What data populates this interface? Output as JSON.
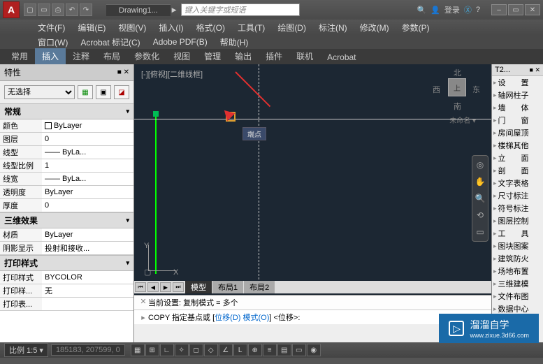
{
  "title": {
    "drawing": "Drawing1...",
    "search_placeholder": "键入关键字或短语",
    "login": "登录"
  },
  "menu1": [
    "文件(F)",
    "编辑(E)",
    "视图(V)",
    "插入(I)",
    "格式(O)",
    "工具(T)",
    "绘图(D)",
    "标注(N)",
    "修改(M)",
    "参数(P)"
  ],
  "menu2": [
    "窗口(W)",
    "Acrobat 标记(C)",
    "Adobe PDF(B)",
    "帮助(H)"
  ],
  "ribbon": [
    "常用",
    "插入",
    "注释",
    "布局",
    "参数化",
    "视图",
    "管理",
    "输出",
    "插件",
    "联机",
    "Acrobat"
  ],
  "ribbon_active": 1,
  "props": {
    "title": "特性",
    "selection": "无选择",
    "sections": {
      "general": {
        "label": "常规",
        "rows": [
          [
            "颜色",
            "ByLayer"
          ],
          [
            "图层",
            "0"
          ],
          [
            "线型",
            "—— ByLa..."
          ],
          [
            "线型比例",
            "1"
          ],
          [
            "线宽",
            "—— ByLa..."
          ],
          [
            "透明度",
            "ByLayer"
          ],
          [
            "厚度",
            "0"
          ]
        ]
      },
      "threeD": {
        "label": "三维效果",
        "rows": [
          [
            "材质",
            "ByLayer"
          ],
          [
            "阴影显示",
            "投射和接收..."
          ]
        ]
      },
      "plot": {
        "label": "打印样式",
        "rows": [
          [
            "打印样式",
            "BYCOLOR"
          ],
          [
            "打印样...",
            "无"
          ],
          [
            "打印表...",
            ""
          ]
        ]
      }
    }
  },
  "canvas": {
    "viewport": "[-][俯视][二维线框]",
    "snap_tip": "端点",
    "viewcube": {
      "n": "北",
      "s": "南",
      "e": "东",
      "w": "西",
      "top": "上"
    },
    "wcs": "未命名 ▾",
    "ucs": {
      "x": "X",
      "y": "Y"
    },
    "tabs": [
      "模型",
      "布局1",
      "布局2"
    ]
  },
  "cmd": {
    "hist": "当前设置:  复制模式 = 多个",
    "prompt_pre": "COPY 指定基点或 [",
    "opt1": "位移(D)",
    "opt_sep": " ",
    "opt2": "模式(O)",
    "prompt_post": "] <位移>:"
  },
  "right_palette": {
    "title": "T2...",
    "items": [
      "设　　置",
      "轴网柱子",
      "墙　　体",
      "门　　窗",
      "房间屋顶",
      "楼梯其他",
      "立　　面",
      "剖　　面",
      "文字表格",
      "尺寸标注",
      "符号标注",
      "图层控制",
      "工　　具",
      "图块图案",
      "建筑防火",
      "场地布置",
      "三维建模",
      "文件布图",
      "数据中心"
    ]
  },
  "status": {
    "scale": "比例 1:5 ▾",
    "coords": "185183, 207599, 0"
  },
  "watermark": {
    "brand": "溜溜自学",
    "url": "www.zixue.3d66.com"
  }
}
